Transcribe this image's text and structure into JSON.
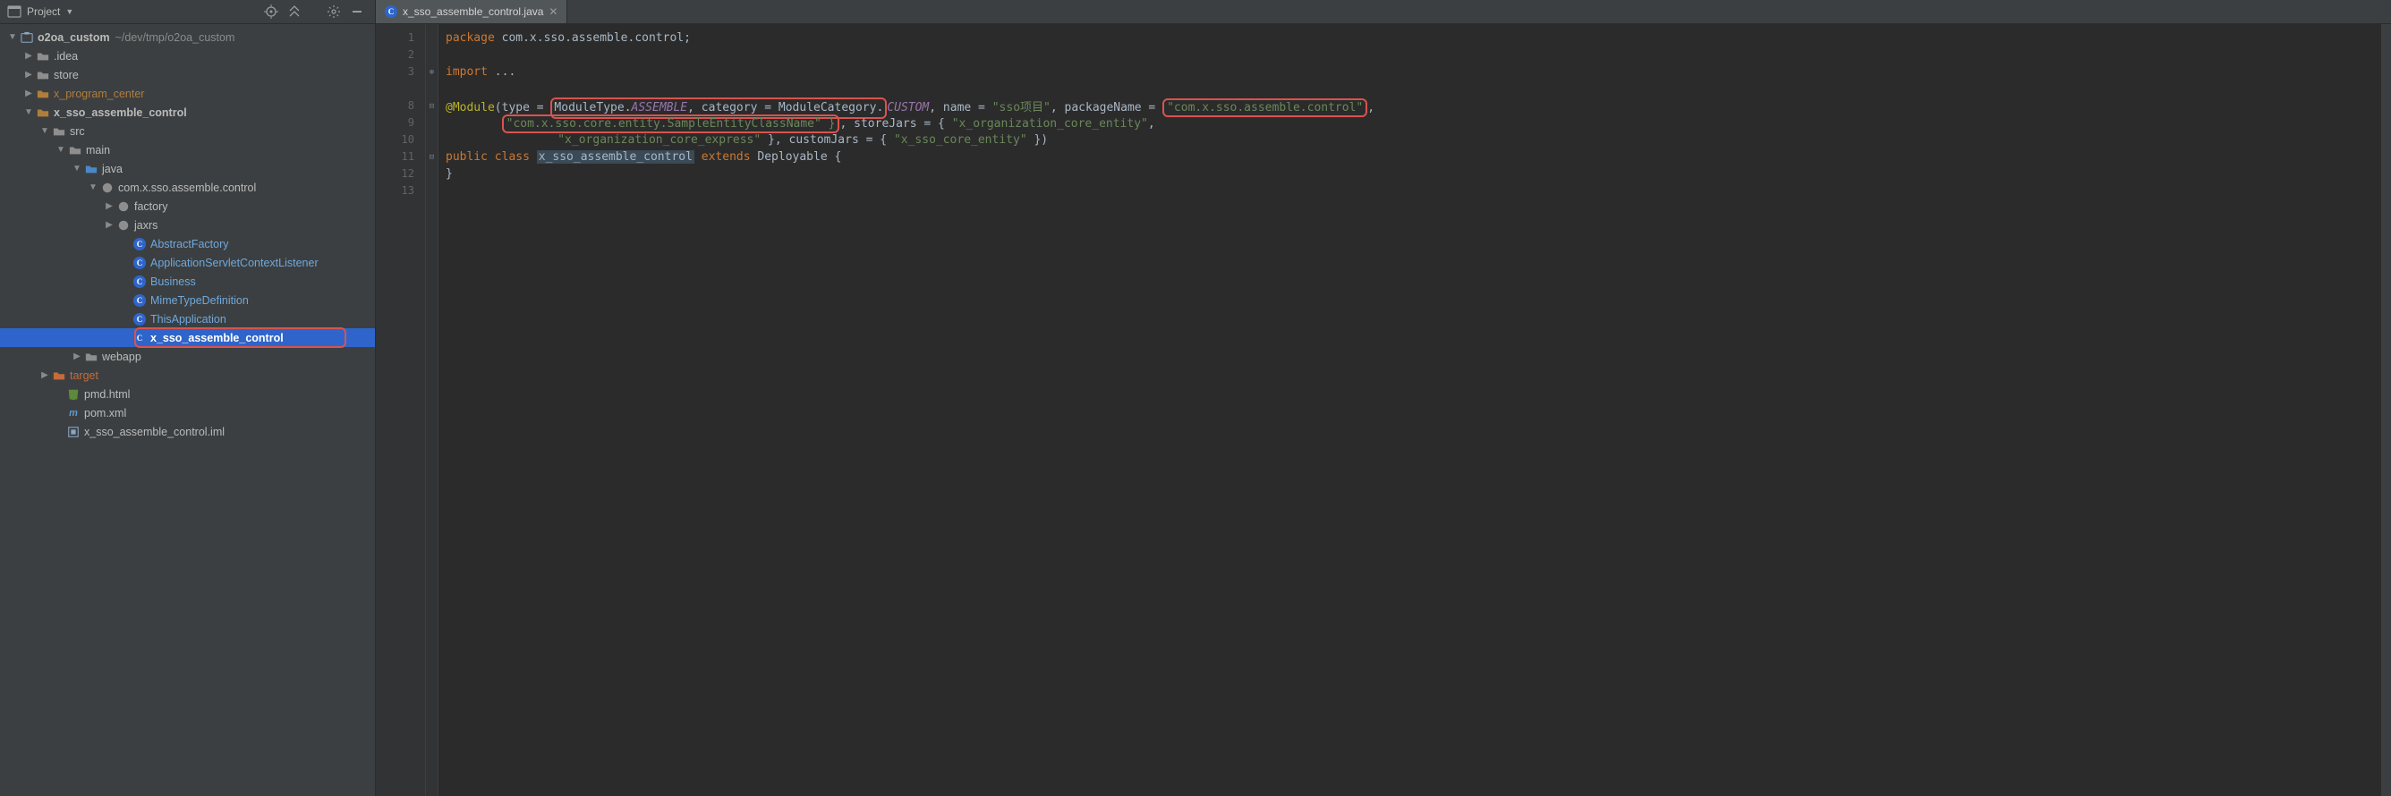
{
  "header": {
    "project_label": "Project"
  },
  "tree": {
    "root": {
      "name": "o2oa_custom",
      "path": "~/dev/tmp/o2oa_custom"
    },
    "items": [
      {
        "name": ".idea",
        "icon": "folder-gray"
      },
      {
        "name": "store",
        "icon": "folder-gray"
      },
      {
        "name": "x_program_center",
        "icon": "folder-gold"
      },
      {
        "name": "x_sso_assemble_control",
        "icon": "folder-gold",
        "expanded": true
      },
      {
        "name": "src",
        "icon": "folder-gray",
        "expanded": true
      },
      {
        "name": "main",
        "icon": "folder-gray",
        "expanded": true
      },
      {
        "name": "java",
        "icon": "folder-blue",
        "expanded": true
      },
      {
        "name": "com.x.sso.assemble.control",
        "icon": "package",
        "expanded": true
      },
      {
        "name": "factory",
        "icon": "package"
      },
      {
        "name": "jaxrs",
        "icon": "package"
      },
      {
        "name": "AbstractFactory",
        "icon": "class"
      },
      {
        "name": "ApplicationServletContextListener",
        "icon": "class"
      },
      {
        "name": "Business",
        "icon": "class"
      },
      {
        "name": "MimeTypeDefinition",
        "icon": "class"
      },
      {
        "name": "ThisApplication",
        "icon": "class"
      },
      {
        "name": "x_sso_assemble_control",
        "icon": "class",
        "selected": true,
        "highlight": true
      },
      {
        "name": "webapp",
        "icon": "folder-gray"
      },
      {
        "name": "target",
        "icon": "folder-gold-muted"
      },
      {
        "name": "pmd.html",
        "icon": "html"
      },
      {
        "name": "pom.xml",
        "icon": "maven"
      },
      {
        "name": "x_sso_assemble_control.iml",
        "icon": "iml"
      }
    ]
  },
  "tab": {
    "label": "x_sso_assemble_control.java"
  },
  "code": {
    "line_numbers": [
      "1",
      "2",
      "3",
      "",
      "8",
      "9",
      "10",
      "11",
      "12",
      "13"
    ],
    "l1_package_kw": "package",
    "l1_package_name": " com.x.sso.assemble.control;",
    "l3_import_kw": "import",
    "l3_ellipsis": " ...",
    "l8_ann": "@Module",
    "l8_type_kw_eq": "(type = ",
    "l8_moduletype": "ModuleType.",
    "l8_assemble": "ASSEMBLE",
    "l8_cat_kw": ", category = ",
    "l8_modulecat": "ModuleCategory.",
    "l8_custom": "CUSTOM",
    "l8_name_kw": ", name = ",
    "l8_name_val": "\"sso项目\"",
    "l8_pkg_kw": ", packageName = ",
    "l8_pkg_val": "\"com.x.sso.assemble.control\"",
    "l8_tail": ",",
    "l9_sample": "\"com.x.sso.core.entity.SampleEntityClassName\" }",
    "l9_storejars": ", storeJars = { ",
    "l9_store_val": "\"x_organization_core_entity\"",
    "l9_tail": ",",
    "l10_express": "\"x_organization_core_express\"",
    "l10_customjars": " }, customJars = { ",
    "l10_custom_val": "\"x_sso_core_entity\"",
    "l10_close": " })",
    "l11_public": "public class ",
    "l11_classname": "x_sso_assemble_control",
    "l11_extends": " extends ",
    "l11_super": "Deployable {",
    "l12_close": "}"
  }
}
